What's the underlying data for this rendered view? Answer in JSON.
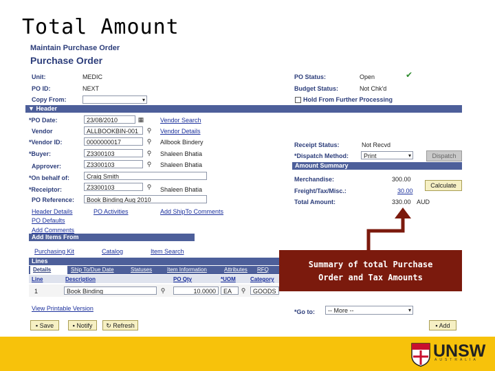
{
  "slide": {
    "title": "Total Amount"
  },
  "page": {
    "breadcrumb": "Maintain Purchase Order",
    "title": "Purchase Order"
  },
  "header_info": {
    "unit_label": "Unit:",
    "unit_value": "MEDIC",
    "poid_label": "PO ID:",
    "poid_value": "NEXT",
    "copyfrom_label": "Copy From:",
    "status_label": "PO Status:",
    "status_value": "Open",
    "budget_label": "Budget Status:",
    "budget_value": "Not Chk'd",
    "hold_label": "Hold From Further Processing"
  },
  "header_section": {
    "label": "Header",
    "toggle_icon": "triangle-down-icon"
  },
  "fields": {
    "po_date_label": "*PO Date:",
    "po_date_value": "23/08/2010",
    "vendor_label": "Vendor",
    "vendor_value": "ALLBOOKBIN-001",
    "vendor_id_label": "*Vendor ID:",
    "vendor_id_value": "0000000017",
    "vendor_id_name": "Allbook Bindery",
    "buyer_label": "*Buyer:",
    "buyer_value": "Z3300103",
    "buyer_name": "Shaleen Bhatia",
    "approver_label": "Approver:",
    "approver_value": "Z3300103",
    "approver_name": "Shaleen Bhatia",
    "onbehalf_label": "*On behalf of:",
    "onbehalf_value": "Craig Smith",
    "receiptor_label": "*Receiptor:",
    "receiptor_value": "Z3300103",
    "receiptor_name": "Shaleen Bhatia",
    "poref_label": "PO Reference:",
    "poref_value": "Book Binding Aug 2010",
    "vendor_search": "Vendor Search",
    "vendor_details": "Vendor Details"
  },
  "right_panel": {
    "receipt_label": "Receipt Status:",
    "receipt_value": "Not Recvd",
    "dispatch_label": "*Dispatch Method:",
    "dispatch_value": "Print",
    "dispatch_btn": "Dispatch",
    "amount_summary": "Amount Summary",
    "merch_label": "Merchandise:",
    "merch_value": "300.00",
    "freight_label": "Freight/Tax/Misc.:",
    "freight_value": "30.00",
    "total_label": "Total Amount:",
    "total_value": "330.00",
    "currency": "AUD",
    "calculate_btn": "Calculate"
  },
  "links": {
    "header_details": "Header Details",
    "po_activities": "PO Activities",
    "add_shipto": "Add ShipTo Comments",
    "po_defaults": "PO Defaults",
    "add_comments": "Add Comments"
  },
  "add_items": {
    "label": "Add Items From",
    "purchasing_kit": "Purchasing Kit",
    "catalog": "Catalog",
    "item_search": "Item Search"
  },
  "lines": {
    "label": "Lines",
    "tabs": [
      "Details",
      "Ship To/Due Date",
      "Statuses",
      "Item Information",
      "Attributes",
      "RFQ"
    ],
    "columns": [
      "Line",
      "Description",
      "PO Qty",
      "*UOM",
      "Category"
    ],
    "row": {
      "line": "1",
      "description": "Book Binding",
      "qty": "10.0000",
      "uom": "EA",
      "category": "GOODS"
    }
  },
  "bottom": {
    "view_printable": "View Printable Version",
    "goto_label": "*Go to:",
    "goto_value": "-- More --",
    "save": "Save",
    "notify": "Notify",
    "refresh": "Refresh",
    "add": "Add"
  },
  "callout": {
    "line1": "Summary of total Purchase",
    "line2": "Order and Tax Amounts"
  },
  "logo": {
    "name": "UNSW",
    "sub": "AUSTRALIA"
  },
  "colors": {
    "accent": "#4d5f9a",
    "callout": "#7b1a0d",
    "footer": "#f7c20b",
    "arrow": "#7b1a0d"
  }
}
